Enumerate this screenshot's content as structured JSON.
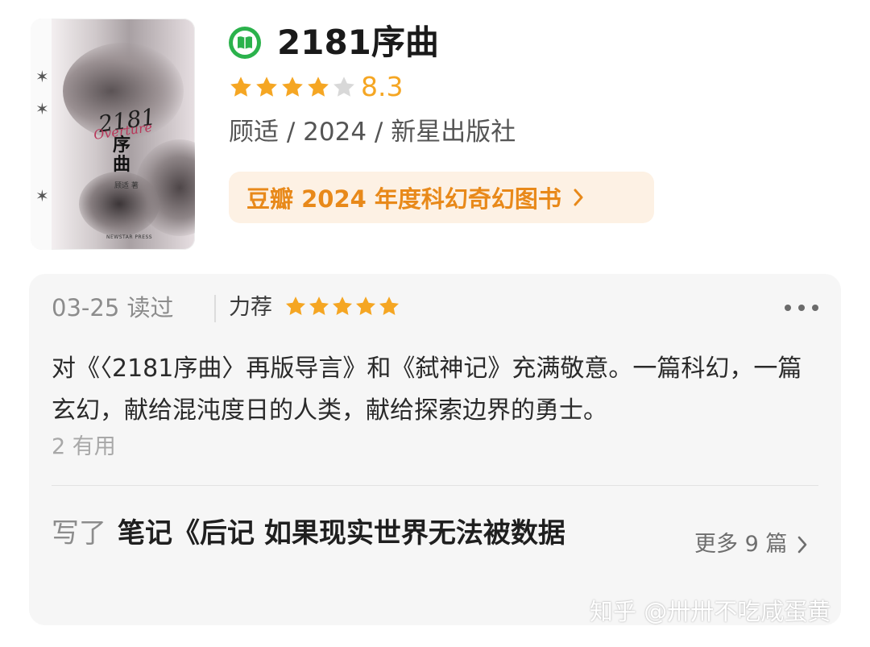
{
  "book": {
    "title": "2181序曲",
    "rating_stars": 4,
    "rating_max": 5,
    "score": "8.3",
    "meta": "顾适 / 2024 / 新星出版社",
    "badge": "豆瓣 2024 年度科幻奇幻图书",
    "cover": {
      "title_number": "2181",
      "title_overlay": "Overture",
      "title_cn": "序曲",
      "author": "顾适 著",
      "publisher_mark": "NEWSTAR PRESS"
    }
  },
  "review": {
    "date": "03-25 读过",
    "recommend_label": "力荐",
    "recommend_stars": 5,
    "text": "对《〈2181序曲〉再版导言》和《弑神记》充满敬意。一篇科幻，一篇玄幻，献给混沌度日的人类，献给探索边界的勇士。",
    "useful": "2 有用",
    "note_prefix": "写了",
    "note_title": "笔记《后记 如果现实世界无法被数据",
    "more_notes": "更多 9 篇"
  },
  "watermark": "知乎 @卅卅不吃咸蛋黄",
  "colors": {
    "star": "#f5a623",
    "star_empty": "#d8d8d8",
    "badge_bg": "#fdf1e4",
    "badge_text": "#e8891a",
    "book_icon": "#2bb24c",
    "card_bg": "#f6f6f6"
  }
}
